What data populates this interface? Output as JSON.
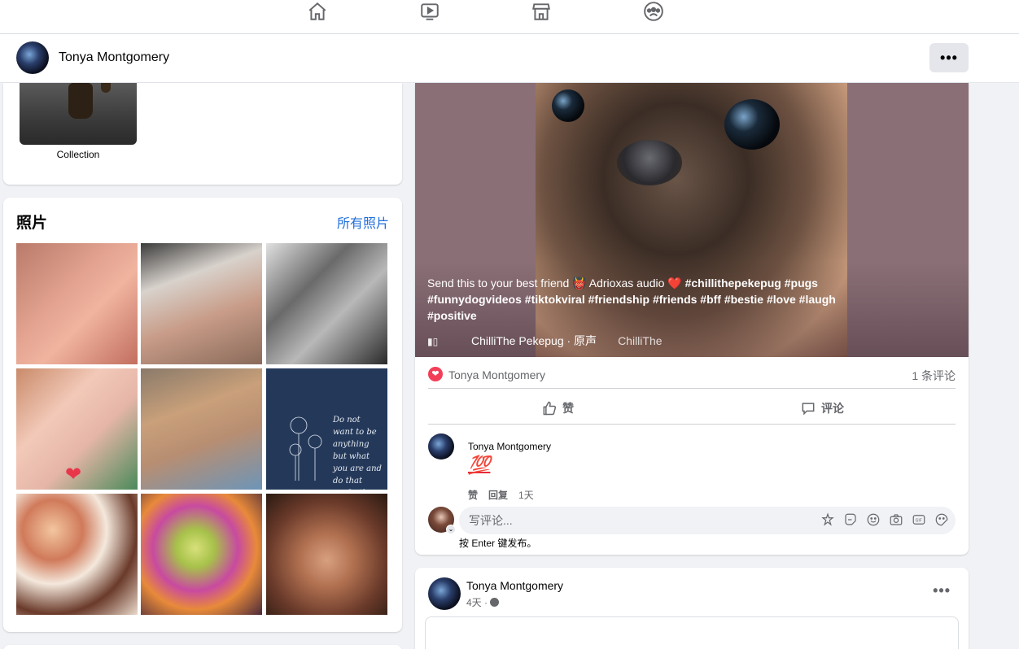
{
  "topnav": {
    "icons": [
      "home-icon",
      "watch-icon",
      "marketplace-icon",
      "groups-icon"
    ]
  },
  "profile": {
    "name": "Tonya Montgomery",
    "more_label": "•••"
  },
  "collection": {
    "label": "Collection"
  },
  "photos": {
    "title": "照片",
    "all_link": "所有照片",
    "quote_text": "Do not want to be anything but what you are and do that perfectly."
  },
  "post": {
    "caption_plain": "Send this to your best friend 👹 Adrioxas audio ❤️ ",
    "hashtags": "#chillithepekepug #pugs #funnydogvideos #tiktokviral #friendship #friends #bff #bestie #love #laugh #positive",
    "audio_label": "ChilliThe Pekepug · 原声",
    "audio_label_2": "ChilliThe",
    "reaction_name": "Tonya Montgomery",
    "comment_count": "1 条评论",
    "like_label": "赞",
    "comment_label": "评论",
    "comment": {
      "author": "Tonya Montgomery",
      "text": "💯",
      "like": "赞",
      "reply": "回复",
      "time": "1天"
    },
    "write_placeholder": "写评论...",
    "enter_hint": "按 Enter 键发布。"
  },
  "post2": {
    "author": "Tonya Montgomery",
    "time": "4天 ·",
    "more_label": "•••"
  },
  "colors": {
    "link": "#216fdb",
    "love": "#f33e58",
    "secondary_text": "#65676b"
  }
}
